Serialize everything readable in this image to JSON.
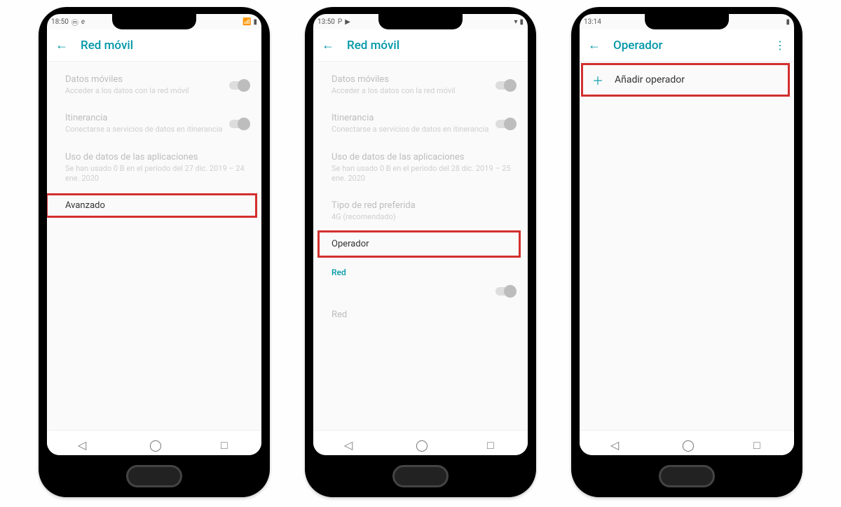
{
  "accent": "#0097a7",
  "highlight_color": "#d32f2f",
  "phones": [
    {
      "time": "18:50",
      "status_icons_left": [
        "moto-icon",
        "e-icon"
      ],
      "title": "Red móvil",
      "items": [
        {
          "title": "Datos móviles",
          "sub": "Acceder a los datos con la red móvil",
          "toggle": true
        },
        {
          "title": "Itinerancia",
          "sub": "Conectarse a servicios de datos en itinerancia",
          "toggle": true
        },
        {
          "title": "Uso de datos de las aplicaciones",
          "sub": "Se han usado 0 B en el periodo del 27 dic. 2019 – 24 ene. 2020"
        },
        {
          "title": "Avanzado",
          "active": true,
          "highlighted": true
        }
      ]
    },
    {
      "time": "13:50",
      "status_icons_left": [
        "p-icon",
        "play-icon"
      ],
      "title": "Red móvil",
      "items": [
        {
          "title": "Datos móviles",
          "sub": "Acceder a los datos con la red móvil",
          "toggle": true
        },
        {
          "title": "Itinerancia",
          "sub": "Conectarse a servicios de datos en itinerancia",
          "toggle": true
        },
        {
          "title": "Uso de datos de las aplicaciones",
          "sub": "Se han usado 0 B en el periodo del 28 dic. 2019 – 25 ene. 2020"
        },
        {
          "title": "Tipo de red preferida",
          "sub": "4G (recomendado)"
        },
        {
          "title": "Operador",
          "active": true,
          "highlighted": true
        }
      ],
      "section_label": "Red",
      "extra_toggle": true,
      "extra_label": "Red"
    },
    {
      "time": "13:14",
      "title": "Operador",
      "overflow": true,
      "add_row": {
        "label": "Añadir operador",
        "highlighted": true
      }
    }
  ],
  "nav": {
    "back": "◀",
    "home": "◉",
    "recent": "■"
  }
}
